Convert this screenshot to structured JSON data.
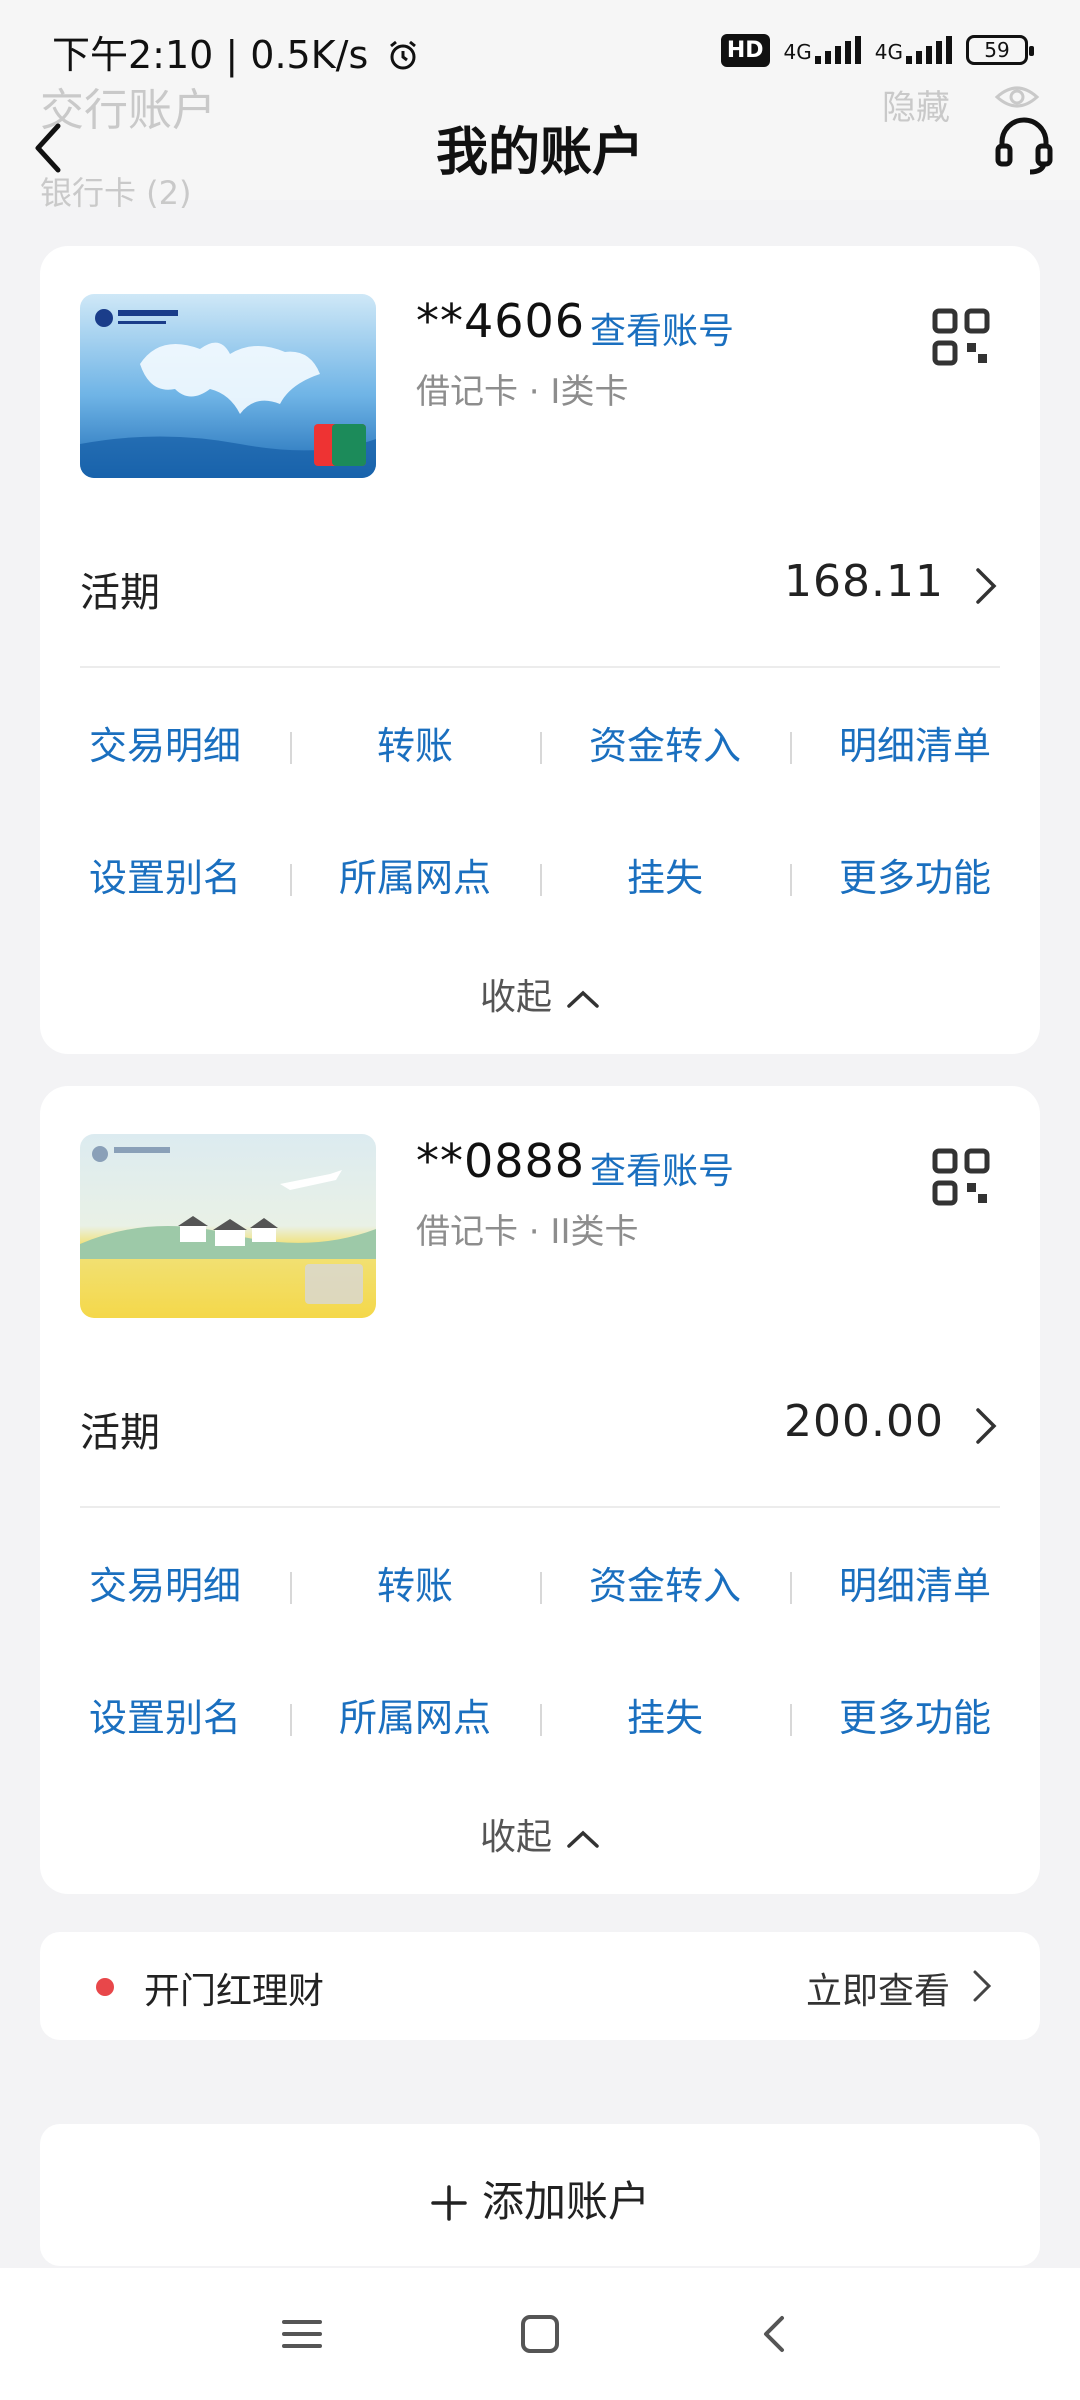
{
  "status_bar": {
    "time": "下午2:10 | 0.5K/s",
    "hd": "HD",
    "net1": "4G",
    "net2": "4G",
    "battery": "59"
  },
  "header": {
    "title": "我的账户",
    "ghost_title": "交行账户",
    "ghost_subtitle": "银行卡 (2)",
    "ghost_hide": "隐藏"
  },
  "cards": [
    {
      "card_no": "**4606",
      "view_no_label": "查看账号",
      "type": "借记卡 · I类卡",
      "balance_label": "活期",
      "balance": "168.11",
      "actions_row1": [
        "交易明细",
        "转账",
        "资金转入",
        "明细清单"
      ],
      "actions_row2": [
        "设置别名",
        "所属网点",
        "挂失",
        "更多功能"
      ],
      "collapse_label": "收起"
    },
    {
      "card_no": "**0888",
      "view_no_label": "查看账号",
      "type": "借记卡 · II类卡",
      "balance_label": "活期",
      "balance": "200.00",
      "actions_row1": [
        "交易明细",
        "转账",
        "资金转入",
        "明细清单"
      ],
      "actions_row2": [
        "设置别名",
        "所属网点",
        "挂失",
        "更多功能"
      ],
      "collapse_label": "收起"
    }
  ],
  "promo": {
    "text": "开门红理财",
    "cta": "立即查看"
  },
  "add_account": {
    "label": "添加账户"
  },
  "colors": {
    "link_blue": "#1a6fbf",
    "promo_dot": "#e8474a",
    "background": "#f3f3f5"
  },
  "icons": [
    "alarm-icon",
    "back-icon",
    "headset-icon",
    "eye-icon",
    "qr-code-icon",
    "chevron-right-icon",
    "chevron-up-icon",
    "plus-icon",
    "menu-icon",
    "home-icon"
  ]
}
